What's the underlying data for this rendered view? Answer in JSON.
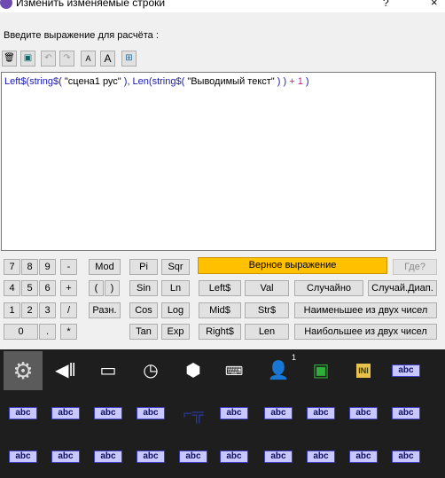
{
  "window": {
    "title": "Изменить изменяемые строки",
    "help": "?",
    "close": "×"
  },
  "prompt": "Введите выражение для расчёта :",
  "toolbar": [
    {
      "name": "delete-icon",
      "glyph": "🗑"
    },
    {
      "name": "insert-icon",
      "glyph": "▣"
    },
    {
      "name": "undo-icon",
      "glyph": "↶"
    },
    {
      "name": "redo-icon",
      "glyph": "↷"
    },
    {
      "name": "font-decrease-icon",
      "glyph": "A"
    },
    {
      "name": "font-increase-icon",
      "glyph": "A"
    },
    {
      "name": "grid-icon",
      "glyph": "⊞"
    }
  ],
  "expression": {
    "part1": "Left$(string$( ",
    "str1": "\"сцена1 рус\"",
    "part2": " ), Len(string$( ",
    "str2": "\"Выводимый текст\"",
    "part3": " ) ) ",
    "op": "+",
    "num": " 1 ",
    "part4": ")"
  },
  "keypad": {
    "k7": "7",
    "k8": "8",
    "k9": "9",
    "minus": "-",
    "k4": "4",
    "k5": "5",
    "k6": "6",
    "plus": "+",
    "k1": "1",
    "k2": "2",
    "k3": "3",
    "div": "/",
    "k0": "0",
    "dot": ".",
    "mul": "*",
    "mod": "Mod",
    "paren_open": "(",
    "paren_close": ")",
    "razn": "Разн."
  },
  "functions": {
    "pi": "Pi",
    "sqr": "Sqr",
    "sin": "Sin",
    "ln": "Ln",
    "cos": "Cos",
    "log": "Log",
    "tan": "Tan",
    "exp": "Exp",
    "left": "Left$",
    "val": "Val",
    "random": "Случайно",
    "random_range": "Случай.Диап.",
    "mid": "Mid$",
    "str": "Str$",
    "min": "Наименьшее из двух чисел",
    "right": "Right$",
    "len": "Len",
    "max": "Наибольшее из двух чисел",
    "where": "Где?"
  },
  "status": "Верное выражение",
  "palette": {
    "abc": "abc",
    "user_badge": "1",
    "ini": "INI"
  }
}
